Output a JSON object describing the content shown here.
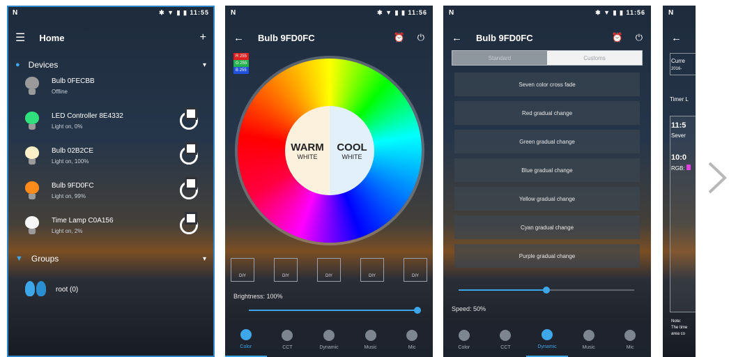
{
  "screens": {
    "home": {
      "status": {
        "time": "11:55",
        "carrier": "N",
        "icons": "✱ ▼ ▮ ▮"
      },
      "title": "Home",
      "sections": {
        "devices": "Devices",
        "groups": "Groups"
      },
      "devices": [
        {
          "name": "Bulb 0FECBB",
          "status": "Offline",
          "color": "#9a9a9a",
          "has_power": false
        },
        {
          "name": "LED Controller 8E4332",
          "status": "Light on, 0%",
          "color": "#2fe07c",
          "has_power": true
        },
        {
          "name": "Bulb 02B2CE",
          "status": "Light on, 100%",
          "color": "#fbf0c8",
          "has_power": true
        },
        {
          "name": "Bulb 9FD0FC",
          "status": "Light on, 99%",
          "color": "#ff8c1a",
          "has_power": true
        },
        {
          "name": "Time Lamp C0A156",
          "status": "Light on, 2%",
          "color": "#f6f6f6",
          "has_power": true
        }
      ],
      "groups": [
        {
          "name": "root (0)"
        }
      ]
    },
    "color": {
      "status": {
        "time": "11:56",
        "carrier": "N",
        "icons": "✱ ▼ ▮ ▮"
      },
      "title": "Bulb 9FD0FC",
      "rgb": {
        "r": "R 255",
        "g": "G 255",
        "b": "B 255"
      },
      "warm": {
        "big": "WARM",
        "small": "WHITE"
      },
      "cool": {
        "big": "COOL",
        "small": "WHITE"
      },
      "diy": [
        "DIY",
        "DIY",
        "DIY",
        "DIY",
        "DIY"
      ],
      "brightness_label": "Brightness: 100%",
      "brightness_value": 100
    },
    "dynamic": {
      "status": {
        "time": "11:56",
        "carrier": "N",
        "icons": "✱ ▼ ▮ ▮"
      },
      "title": "Bulb 9FD0FC",
      "segments": {
        "left": "Standard",
        "right": "Customs"
      },
      "modes": [
        "Seven color cross fade",
        "Red gradual change",
        "Green gradual change",
        "Blue gradual change",
        "Yellow gradual change",
        "Cyan gradual change",
        "Purple gradual change"
      ],
      "speed_label": "Speed: 50%",
      "speed_value": 50
    },
    "timer": {
      "status": {
        "carrier": "N"
      },
      "items": {
        "current": "Curre",
        "date": "2016-",
        "timer_label": "Timer L",
        "time1": "11:5",
        "mode1": "Sever",
        "time2": "10:0",
        "rgb": "RGB:",
        "note1": "Note:",
        "note2": "The time",
        "note3": "area co"
      }
    }
  },
  "tabs": [
    "Color",
    "CCT",
    "Dynamic",
    "Music",
    "Mic"
  ],
  "colors": {
    "accent": "#3ea7ea"
  }
}
